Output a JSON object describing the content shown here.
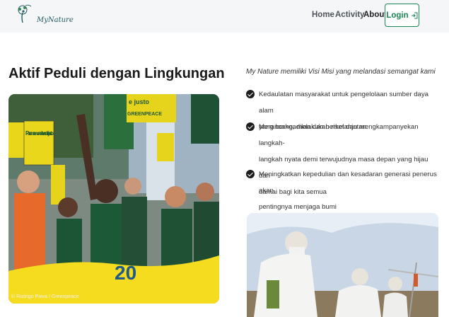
{
  "navbar": {
    "logo_text": "MyNature",
    "links": [
      "Home",
      "Activity",
      "About"
    ],
    "login_label": "Login",
    "login_icon": "login-arrow-icon"
  },
  "section": {
    "title": "Aktif Peduli dengan Lingkungan",
    "photo1_caption": "© Rodrigo Paiva / Greenpeace",
    "photo1_signs": [
      "Por um mundo verde e justo",
      "e justo",
      "GREENPEACE",
      "20"
    ]
  },
  "mission": {
    "intro": "My Nature memiliki Visi Misi yang melandasi semangat kami",
    "items": [
      {
        "lines": [
          "Kedaulatan masyarakat untuk pengelolaan sumber daya alam",
          "yang berkeadilan dan berkelanjutan"
        ]
      },
      {
        "lines": [
          "Merancang, melakukan riset dan mengkampanyekan langkah-",
          "langkah nyata demi terwujudnya masa depan yang hijau dan",
          "damai bagi kita semua"
        ]
      },
      {
        "lines": [
          "Meningkatkan kepedulian dan kesadaran generasi penerus akan",
          "pentingnya menjaga bumi"
        ]
      }
    ]
  },
  "colors": {
    "accent": "#198754",
    "navbar_bg": "#f4f6f8",
    "banner_yellow": "#f5dc1e"
  }
}
